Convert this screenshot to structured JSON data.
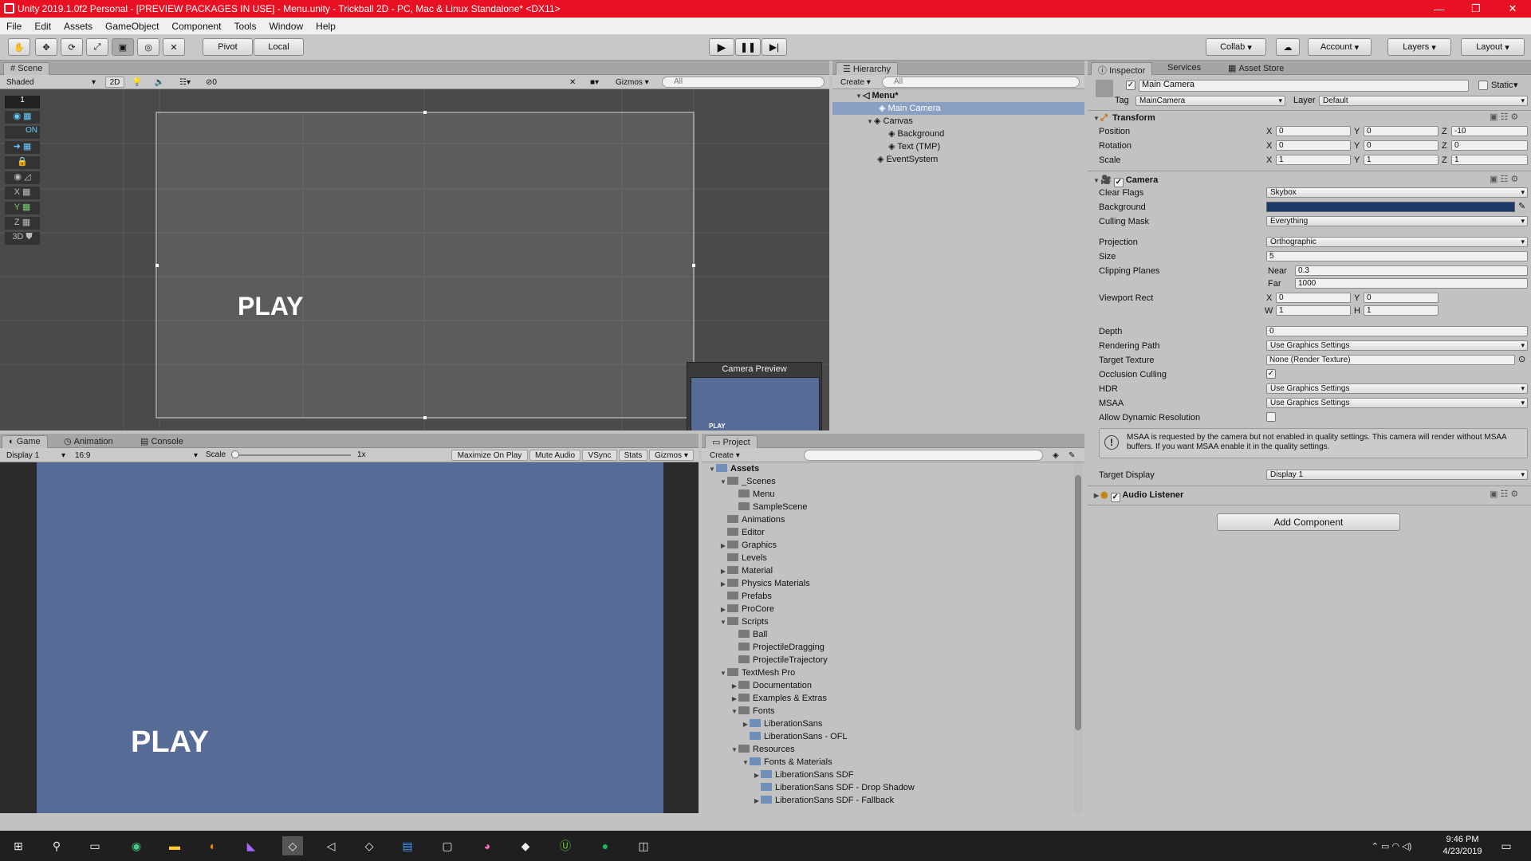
{
  "window": {
    "title": "Unity 2019.1.0f2 Personal - [PREVIEW PACKAGES IN USE] - Menu.unity - Trickball 2D - PC, Mac & Linux Standalone* <DX11>"
  },
  "menu": [
    "File",
    "Edit",
    "Assets",
    "GameObject",
    "Component",
    "Tools",
    "Window",
    "Help"
  ],
  "toolbar": {
    "pivot": "Pivot",
    "local": "Local",
    "collab": "Collab",
    "account": "Account",
    "layers": "Layers",
    "layout": "Layout"
  },
  "scene": {
    "tab": "Scene",
    "shade": "Shaded",
    "mode2d": "2D",
    "gizmos": "Gizmos",
    "search": "All",
    "fx_count": "0",
    "play_text": "PLAY",
    "camera_preview": "Camera Preview",
    "preview_play": "PLAY",
    "sidebar": [
      "1",
      "ON",
      "X",
      "Y",
      "Z",
      "3D"
    ]
  },
  "hierarchy": {
    "tab": "Hierarchy",
    "create": "Create",
    "search": "All",
    "items": [
      {
        "label": "Menu*"
      },
      {
        "label": "Main Camera"
      },
      {
        "label": "Canvas"
      },
      {
        "label": "Background"
      },
      {
        "label": "Text (TMP)"
      },
      {
        "label": "EventSystem"
      }
    ]
  },
  "inspector": {
    "tabs": [
      "Inspector",
      "Services",
      "Asset Store"
    ],
    "object_name": "Main Camera",
    "static_label": "Static",
    "tag_label": "Tag",
    "tag_value": "MainCamera",
    "layer_label": "Layer",
    "layer_value": "Default",
    "transform": {
      "title": "Transform",
      "position_label": "Position",
      "rotation_label": "Rotation",
      "scale_label": "Scale",
      "position": [
        "0",
        "0",
        "-10"
      ],
      "rotation": [
        "0",
        "0",
        "0"
      ],
      "scale": [
        "1",
        "1",
        "1"
      ]
    },
    "axes": [
      "X",
      "Y",
      "Z",
      "W",
      "H"
    ],
    "camera": {
      "title": "Camera",
      "clear_flags": "Clear Flags",
      "clear_flags_value": "Skybox",
      "background": "Background",
      "background_color": "#1c3a6a",
      "culling_mask": "Culling Mask",
      "culling_mask_value": "Everything",
      "projection": "Projection",
      "projection_value": "Orthographic",
      "size": "Size",
      "size_value": "5",
      "clipping": "Clipping Planes",
      "near": "Near",
      "near_value": "0.3",
      "far": "Far",
      "far_value": "1000",
      "viewport": "Viewport Rect",
      "vx": "0",
      "vy": "0",
      "vw": "1",
      "vh": "1",
      "depth": "Depth",
      "depth_value": "0",
      "rendering_path": "Rendering Path",
      "rendering_path_value": "Use Graphics Settings",
      "target_texture": "Target Texture",
      "target_texture_value": "None (Render Texture)",
      "occlusion": "Occlusion Culling",
      "hdr": "HDR",
      "hdr_value": "Use Graphics Settings",
      "msaa": "MSAA",
      "msaa_value": "Use Graphics Settings",
      "dynres": "Allow Dynamic Resolution",
      "warning": "MSAA is requested by the camera but not enabled in quality settings. This camera will render without MSAA buffers. If you want MSAA enable it in the quality settings.",
      "target_display": "Target Display",
      "target_display_value": "Display 1"
    },
    "audio_listener": "Audio Listener",
    "add_component": "Add Component"
  },
  "game": {
    "tabs": [
      "Game",
      "Animation",
      "Console"
    ],
    "display": "Display 1",
    "aspect": "16:9",
    "scale_label": "Scale",
    "scale_value": "1x",
    "buttons": [
      "Maximize On Play",
      "Mute Audio",
      "VSync",
      "Stats",
      "Gizmos"
    ],
    "play_text": "PLAY"
  },
  "project": {
    "tab": "Project",
    "create": "Create",
    "tree": [
      {
        "label": "Assets",
        "d": 0,
        "arrow": "open"
      },
      {
        "label": "_Scenes",
        "d": 1,
        "arrow": "open"
      },
      {
        "label": "Menu",
        "d": 2,
        "arrow": ""
      },
      {
        "label": "SampleScene",
        "d": 2,
        "arrow": ""
      },
      {
        "label": "Animations",
        "d": 1,
        "arrow": ""
      },
      {
        "label": "Editor",
        "d": 1,
        "arrow": ""
      },
      {
        "label": "Graphics",
        "d": 1,
        "arrow": "closed"
      },
      {
        "label": "Levels",
        "d": 1,
        "arrow": ""
      },
      {
        "label": "Material",
        "d": 1,
        "arrow": "closed"
      },
      {
        "label": "Physics Materials",
        "d": 1,
        "arrow": "closed"
      },
      {
        "label": "Prefabs",
        "d": 1,
        "arrow": ""
      },
      {
        "label": "ProCore",
        "d": 1,
        "arrow": "closed"
      },
      {
        "label": "Scripts",
        "d": 1,
        "arrow": "open"
      },
      {
        "label": "Ball",
        "d": 2,
        "arrow": ""
      },
      {
        "label": "ProjectileDragging",
        "d": 2,
        "arrow": ""
      },
      {
        "label": "ProjectileTrajectory",
        "d": 2,
        "arrow": ""
      },
      {
        "label": "TextMesh Pro",
        "d": 1,
        "arrow": "open"
      },
      {
        "label": "Documentation",
        "d": 2,
        "arrow": "closed"
      },
      {
        "label": "Examples & Extras",
        "d": 2,
        "arrow": "closed"
      },
      {
        "label": "Fonts",
        "d": 2,
        "arrow": "open"
      },
      {
        "label": "LiberationSans",
        "d": 3,
        "arrow": "closed"
      },
      {
        "label": "LiberationSans - OFL",
        "d": 3,
        "arrow": ""
      },
      {
        "label": "Resources",
        "d": 2,
        "arrow": "open"
      },
      {
        "label": "Fonts & Materials",
        "d": 3,
        "arrow": "open"
      },
      {
        "label": "LiberationSans SDF",
        "d": 4,
        "arrow": "closed"
      },
      {
        "label": "LiberationSans SDF - Drop Shadow",
        "d": 4,
        "arrow": ""
      },
      {
        "label": "LiberationSans SDF - Fallback",
        "d": 4,
        "arrow": "closed"
      }
    ]
  },
  "taskbar": {
    "time": "9:46 PM",
    "date": "4/23/2019"
  }
}
